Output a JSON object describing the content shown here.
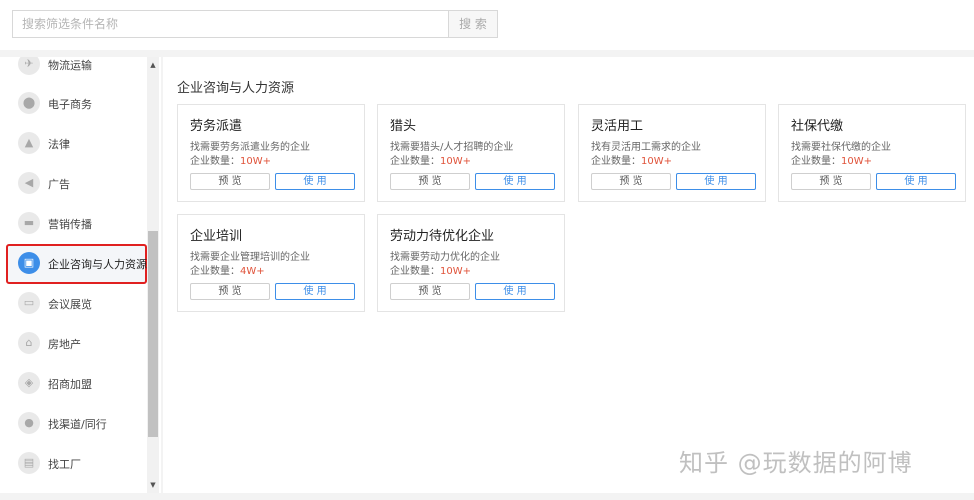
{
  "search": {
    "placeholder": "搜索筛选条件名称",
    "button_label": "搜 索"
  },
  "sidebar": {
    "items": [
      {
        "label": "物流运输",
        "icon": "truck-icon",
        "glyph": "✈"
      },
      {
        "label": "电子商务",
        "icon": "shop-icon",
        "glyph": "⬤"
      },
      {
        "label": "法律",
        "icon": "gavel-icon",
        "glyph": "▲"
      },
      {
        "label": "广告",
        "icon": "megaphone-icon",
        "glyph": "◀"
      },
      {
        "label": "营销传播",
        "icon": "broadcast-icon",
        "glyph": "▬"
      },
      {
        "label": "企业咨询与人力资源",
        "icon": "briefcase-icon",
        "glyph": "▣"
      },
      {
        "label": "会议展览",
        "icon": "presentation-icon",
        "glyph": "▭"
      },
      {
        "label": "房地产",
        "icon": "house-icon",
        "glyph": "⌂"
      },
      {
        "label": "招商加盟",
        "icon": "handshake-icon",
        "glyph": "◈"
      },
      {
        "label": "找渠道/同行",
        "icon": "person-icon",
        "glyph": "●"
      },
      {
        "label": "找工厂",
        "icon": "factory-icon",
        "glyph": "▤"
      }
    ],
    "active_index": 5
  },
  "main": {
    "section_title": "企业咨询与人力资源",
    "count_prefix": "企业数量：",
    "preview_label": "预 览",
    "use_label": "使 用",
    "cards": [
      {
        "title": "劳务派遣",
        "desc": "找需要劳务派遣业务的企业",
        "count": "10W+"
      },
      {
        "title": "猎头",
        "desc": "找需要猎头/人才招聘的企业",
        "count": "10W+"
      },
      {
        "title": "灵活用工",
        "desc": "找有灵活用工需求的企业",
        "count": "10W+"
      },
      {
        "title": "社保代缴",
        "desc": "找需要社保代缴的企业",
        "count": "10W+"
      },
      {
        "title": "企业培训",
        "desc": "找需要企业管理培训的企业",
        "count": "4W+"
      },
      {
        "title": "劳动力待优化企业",
        "desc": "找需要劳动力优化的企业",
        "count": "10W+"
      }
    ]
  },
  "watermark": "知乎 @玩数据的阿博",
  "colors": {
    "accent": "#3d8ee8",
    "highlight_border": "#e02020",
    "count_value": "#e0533a"
  }
}
